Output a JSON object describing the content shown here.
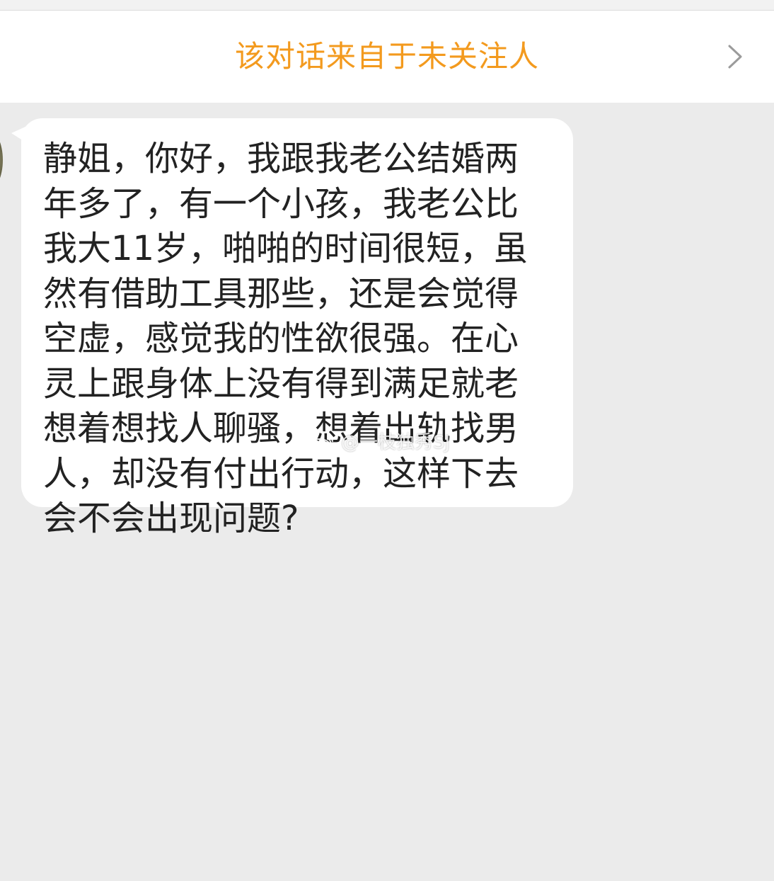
{
  "notice": {
    "text": "该对话来自于未关注人",
    "color": "#f39a1e",
    "chevron_icon": "chevron-right-icon"
  },
  "message": {
    "text": "静姐，你好，我跟我老公结婚两年多了，有一个小孩，我老公比我大11岁，啪啪的时间很短，虽然有借助工具那些，还是会觉得空虚，感觉我的性欲很强。在心灵上跟身体上没有得到满足就老想着想找人聊骚，想着出轨找男人，却没有付出行动，这样下去会不会出现问题?"
  },
  "watermark": {
    "icon": "weibo-icon",
    "text": "@一枝独秀SJ"
  }
}
